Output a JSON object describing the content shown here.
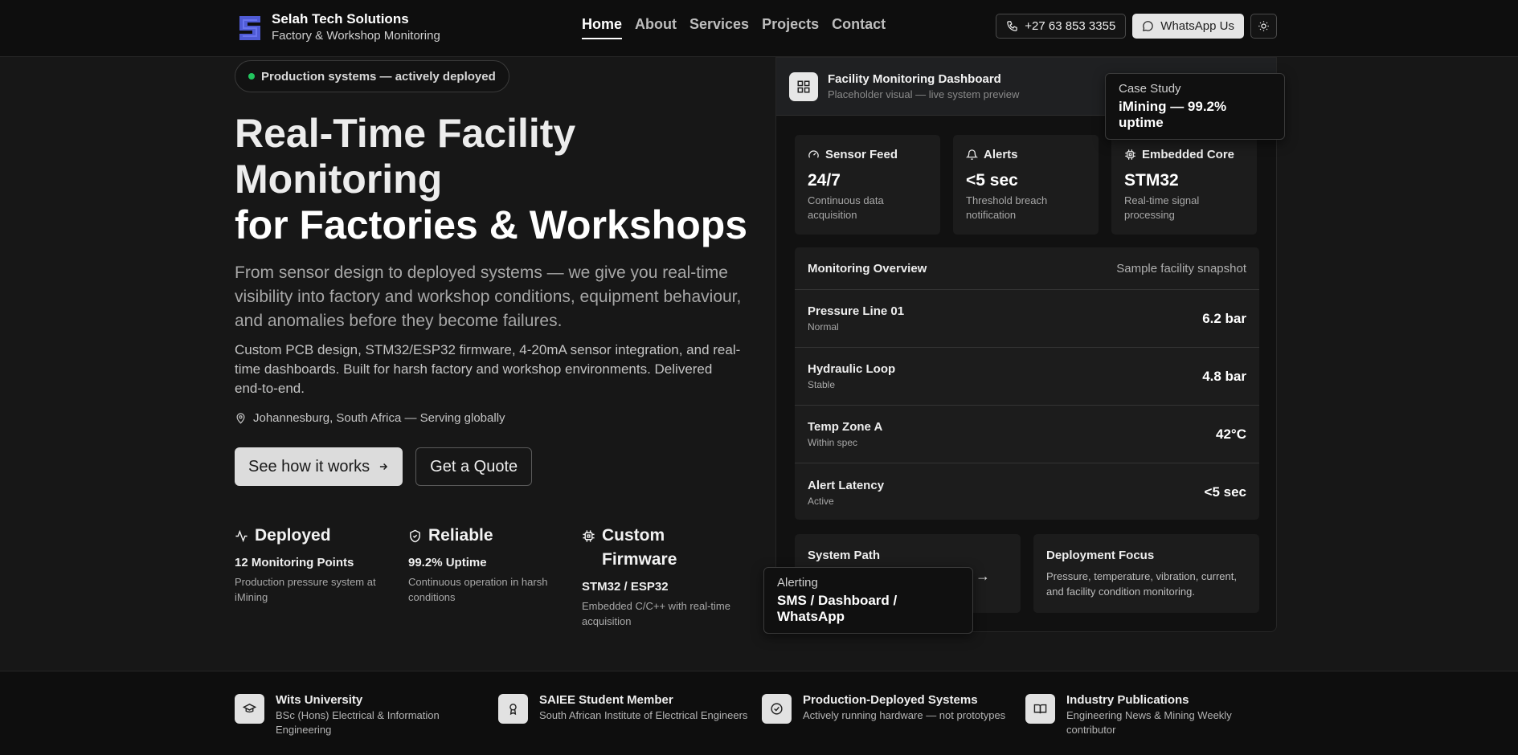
{
  "header": {
    "brand_name": "Selah Tech Solutions",
    "brand_tagline": "Factory & Workshop Monitoring",
    "nav": [
      "Home",
      "About",
      "Services",
      "Projects",
      "Contact"
    ],
    "phone_label": "+27 63 853 3355",
    "whatsapp_label": "WhatsApp Us",
    "theme_icon": "sun-icon"
  },
  "hero": {
    "badge": "Production systems — actively deployed",
    "title_line1": "Real-Time Facility",
    "title_line2": "Monitoring",
    "title_line3": "for Factories & Workshops",
    "subtitle": "From sensor design to deployed systems — we give you real-time visibility into factory and workshop conditions, equipment behaviour, and anomalies before they become failures.",
    "description": "Custom PCB design, STM32/ESP32 firmware, 4-20mA sensor integration, and real-time dashboards. Built for harsh factory and workshop environments. Delivered end-to-end.",
    "location": "Johannesburg, South Africa — Serving globally",
    "cta_primary": "See how it works",
    "cta_secondary": "Get a Quote",
    "stats": [
      {
        "icon": "activity-icon",
        "title": "Deployed",
        "value": "12 Monitoring Points",
        "note": "Production pressure system at iMining"
      },
      {
        "icon": "shield-check-icon",
        "title": "Reliable",
        "value": "99.2% Uptime",
        "note": "Continuous operation in harsh conditions"
      },
      {
        "icon": "chip-icon",
        "title": "Custom Firmware",
        "value": "STM32 / ESP32",
        "note": "Embedded C/C++ with real-time acquisition"
      }
    ]
  },
  "dashboard": {
    "title": "Facility Monitoring Dashboard",
    "subtitle": "Placeholder visual — live system preview",
    "tiles": [
      {
        "icon": "gauge-icon",
        "label": "Sensor Feed",
        "value": "24/7",
        "note": "Continuous data acquisition"
      },
      {
        "icon": "bell-icon",
        "label": "Alerts",
        "value": "<5 sec",
        "note": "Threshold breach notification"
      },
      {
        "icon": "cpu-icon",
        "label": "Embedded Core",
        "value": "STM32",
        "note": "Real-time signal processing"
      }
    ],
    "overview": {
      "title": "Monitoring Overview",
      "subtitle": "Sample facility snapshot",
      "rows": [
        {
          "name": "Pressure Line 01",
          "status": "Normal",
          "value": "6.2 bar"
        },
        {
          "name": "Hydraulic Loop",
          "status": "Stable",
          "value": "4.8 bar"
        },
        {
          "name": "Temp Zone A",
          "status": "Within spec",
          "value": "42°C"
        },
        {
          "name": "Alert Latency",
          "status": "Active",
          "value": "<5 sec"
        }
      ]
    },
    "system_path_title": "System Path",
    "system_path_arrow": "→",
    "focus_title": "Deployment Focus",
    "focus_text": "Pressure, temperature, vibration, current, and facility condition monitoring."
  },
  "callouts": {
    "case_study_label": "Case Study",
    "case_study_value": "iMining — 99.2% uptime",
    "alerting_label": "Alerting",
    "alerting_value": "SMS / Dashboard / WhatsApp"
  },
  "credentials": [
    {
      "icon": "graduation-cap-icon",
      "title": "Wits University",
      "sub": "BSc (Hons) Electrical & Information Engineering"
    },
    {
      "icon": "award-icon",
      "title": "SAIEE Student Member",
      "sub": "South African Institute of Electrical Engineers"
    },
    {
      "icon": "check-circle-icon",
      "title": "Production-Deployed Systems",
      "sub": "Actively running hardware — not prototypes"
    },
    {
      "icon": "book-open-icon",
      "title": "Industry Publications",
      "sub": "Engineering News & Mining Weekly contributor"
    }
  ],
  "colors": {
    "background": "#171717",
    "header_bg": "#0e0e0e",
    "status_green": "#22c55e",
    "logo_blue": "#4f5bd5"
  }
}
